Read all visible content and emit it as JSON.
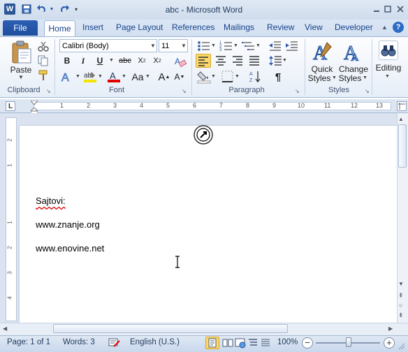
{
  "window": {
    "title": "abc - Microsoft Word",
    "app_icon": "W"
  },
  "tabs": [
    {
      "label": "File"
    },
    {
      "label": "Home"
    },
    {
      "label": "Insert"
    },
    {
      "label": "Page Layout"
    },
    {
      "label": "References"
    },
    {
      "label": "Mailings"
    },
    {
      "label": "Review"
    },
    {
      "label": "View"
    },
    {
      "label": "Developer"
    }
  ],
  "clipboard": {
    "paste_label": "Paste",
    "group_label": "Clipboard"
  },
  "font": {
    "name": "Calibri (Body)",
    "size": "11",
    "group_label": "Font"
  },
  "paragraph": {
    "group_label": "Paragraph"
  },
  "styles": {
    "quick_line1": "Quick",
    "quick_line2": "Styles",
    "change_line1": "Change",
    "change_line2": "Styles",
    "group_label": "Styles"
  },
  "editing": {
    "label": "Editing"
  },
  "ruler": {
    "h_numbers": [
      "1",
      "2",
      "3",
      "4",
      "5",
      "6",
      "7",
      "8",
      "9",
      "10",
      "11",
      "12",
      "13"
    ],
    "v_numbers": [
      "2",
      "1",
      "1",
      "2",
      "3",
      "4"
    ],
    "tab_stop": "L"
  },
  "document": {
    "lines": [
      "Sajtovi:",
      "www.znanje.org",
      "www.enovine.net"
    ]
  },
  "status": {
    "page": "Page: 1 of 1",
    "words": "Words: 3",
    "language": "English (U.S.)",
    "zoom": "100%",
    "zoom_minus": "−",
    "zoom_plus": "+"
  },
  "colors": {
    "accent": "#2b5797",
    "file_tab": "#1f4e9c",
    "highlight": "#f5e400",
    "font_color": "#e30000"
  }
}
